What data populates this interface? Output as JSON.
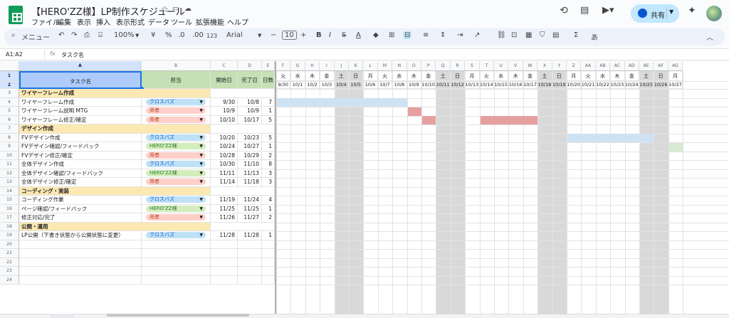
{
  "title": "【HERO'ZZ様】LP制作スケジュール",
  "menus": [
    "ファイル",
    "編集",
    "表示",
    "挿入",
    "表示形式",
    "データ",
    "ツール",
    "拡張機能",
    "ヘルプ"
  ],
  "share_label": "共有",
  "toolbar": {
    "search": "メニュー",
    "zoom": "100%",
    "currency": "¥",
    "percent": "%",
    "dec_less": ".0",
    "dec_more": ".00",
    "num_fmt": "123",
    "font": "Arial",
    "font_size": "10",
    "bold": "B",
    "italic": "I",
    "strike": "S",
    "text_color": "A",
    "sum": "Σ",
    "input_tools": "あ"
  },
  "formula_bar": {
    "name_box": "A1:A2",
    "fx": "fx",
    "content": "タスク名"
  },
  "columns": {
    "main": [
      "A",
      "B",
      "C",
      "D",
      "E"
    ],
    "gantt": [
      "F",
      "G",
      "H",
      "I",
      "J",
      "K",
      "L",
      "M",
      "N",
      "O",
      "P",
      "Q",
      "R",
      "S",
      "T",
      "U",
      "V",
      "W",
      "X",
      "Y",
      "Z",
      "AA",
      "AB",
      "AC",
      "AD",
      "AE",
      "AF",
      "AG"
    ]
  },
  "header": {
    "task": "タスク名",
    "owner": "担当",
    "start": "開始日",
    "end": "完了日",
    "days": "日数"
  },
  "weekdays": [
    "火",
    "水",
    "木",
    "金",
    "土",
    "日",
    "月",
    "火",
    "水",
    "木",
    "金",
    "土",
    "日",
    "月",
    "火",
    "水",
    "木",
    "金",
    "土",
    "日",
    "月",
    "火",
    "水",
    "木",
    "金",
    "土",
    "日",
    "月"
  ],
  "dates": [
    "9/30",
    "10/1",
    "10/2",
    "10/3",
    "10/4",
    "10/5",
    "10/6",
    "10/7",
    "10/8",
    "10/9",
    "10/10",
    "10/11",
    "10/12",
    "10/13",
    "10/14",
    "10/15",
    "10/16",
    "10/17",
    "10/18",
    "10/19",
    "10/20",
    "10/21",
    "10/22",
    "10/23",
    "10/24",
    "10/25",
    "10/26",
    "10/27"
  ],
  "rows": [
    {
      "section": "ワイヤーフレーム作成"
    },
    {
      "task": "ワイヤーフレーム作成",
      "owner": "クロスバズ",
      "start": "9/30",
      "end": "10/8",
      "days": "7"
    },
    {
      "task": "ワイヤーフレーム説明 MTG",
      "owner": "両者",
      "start": "10/9",
      "end": "10/9",
      "days": "1"
    },
    {
      "task": "ワイヤーフレーム修正/確定",
      "owner": "両者",
      "start": "10/10",
      "end": "10/17",
      "days": "5"
    },
    {
      "section": "デザイン作成"
    },
    {
      "task": "FVデザイン作成",
      "owner": "クロスバズ",
      "start": "10/20",
      "end": "10/23",
      "days": "5"
    },
    {
      "task": "FVデザイン確認/フィードバック",
      "owner": "HERO'ZZ様",
      "start": "10/24",
      "end": "10/27",
      "days": "1"
    },
    {
      "task": "FVデザイン修正/確定",
      "owner": "両者",
      "start": "10/28",
      "end": "10/29",
      "days": "2"
    },
    {
      "task": "全体デザイン作成",
      "owner": "クロスバズ",
      "start": "10/30",
      "end": "11/10",
      "days": "8"
    },
    {
      "task": "全体デザイン確認/フィードバック",
      "owner": "HERO'ZZ様",
      "start": "11/11",
      "end": "11/13",
      "days": "3"
    },
    {
      "task": "全体デザイン修正/確定",
      "owner": "両者",
      "start": "11/14",
      "end": "11/18",
      "days": "3"
    },
    {
      "section": "コーディング・実装"
    },
    {
      "task": "コーディング作業",
      "owner": "クロスバズ",
      "start": "11/19",
      "end": "11/24",
      "days": "4"
    },
    {
      "task": "ページ確認/フィードバック",
      "owner": "HERO'ZZ様",
      "start": "11/25",
      "end": "11/25",
      "days": "1"
    },
    {
      "task": "修正対応/完了",
      "owner": "両者",
      "start": "11/26",
      "end": "11/27",
      "days": "2"
    },
    {
      "section": "公開・運用"
    },
    {
      "task": "LP公開（下書き状態から公開状態に変更）",
      "owner": "クロスバズ",
      "start": "11/28",
      "end": "11/28",
      "days": "1"
    }
  ],
  "colors": {
    "section": "#fce8b2",
    "header": "#c5e0b4",
    "header_sel": "#aecbfa",
    "weekend": "#d9d9d9",
    "bar_blue": "#cfe2f3",
    "bar_red": "#e6a0a0",
    "bar_green": "#d9ead3",
    "chip_blue": "#bfe1f6",
    "chip_orange": "#ffcfc9",
    "chip_green": "#d4edbc",
    "sheet_tab": "#e8eaed"
  },
  "owner_colors": {
    "クロスバズ": "chip_blue",
    "両者": "chip_orange",
    "HERO'ZZ様": "chip_green"
  },
  "bars": [
    {
      "row": 4,
      "from": 0,
      "to": 8,
      "color": "bar_blue"
    },
    {
      "row": 5,
      "from": 9,
      "to": 9,
      "color": "bar_red"
    },
    {
      "row": 6,
      "from": 10,
      "to": 10,
      "color": "bar_red"
    },
    {
      "row": 6,
      "from": 14,
      "to": 17,
      "color": "bar_red"
    },
    {
      "row": 8,
      "from": 20,
      "to": 25,
      "color": "bar_blue"
    },
    {
      "row": 9,
      "from": 27,
      "to": 27,
      "color": "bar_green"
    }
  ],
  "total_rows": 24
}
